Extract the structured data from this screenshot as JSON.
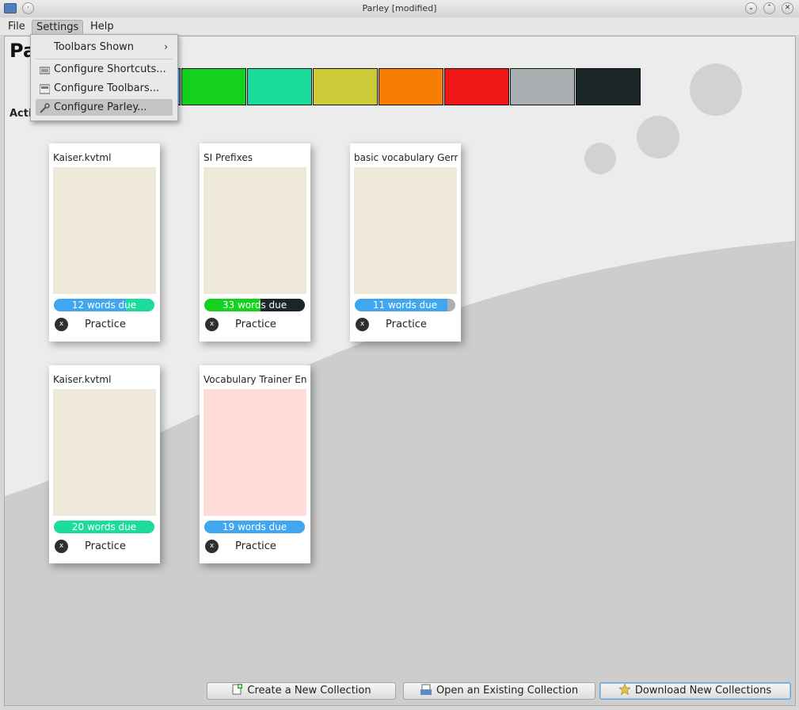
{
  "window": {
    "title": "Parley [modified]"
  },
  "menubar": {
    "file": "File",
    "settings": "Settings",
    "help": "Help"
  },
  "settings_menu": {
    "toolbars_shown": "Toolbars Shown",
    "configure_shortcuts": "Configure Shortcuts...",
    "configure_toolbars": "Configure Toolbars...",
    "configure_parley": "Configure Parley..."
  },
  "page": {
    "title": "Pa",
    "section_label": "Activ"
  },
  "color_strip": [
    "#41a6f0",
    "#14d11e",
    "#1bdc9c",
    "#cccc3a",
    "#f77e03",
    "#ee1616",
    "#aab0b1",
    "#1b2628"
  ],
  "collections": [
    {
      "title": "Kaiser.kvtml",
      "due_label": "12 words due",
      "image_color": "#eee8d8",
      "bar": [
        {
          "color": "#41a6f0",
          "fraction": 0.72
        },
        {
          "color": "#1bdc9c",
          "fraction": 0.28
        }
      ],
      "practice": "Practice"
    },
    {
      "title": "SI Prefixes",
      "due_label": "33 words due",
      "image_color": "#eee8d8",
      "bar": [
        {
          "color": "#14d11e",
          "fraction": 0.56
        },
        {
          "color": "#1b2628",
          "fraction": 0.44
        }
      ],
      "practice": "Practice"
    },
    {
      "title": "basic vocabulary Gern",
      "due_label": "11 words due",
      "image_color": "#eee8d8",
      "bar": [
        {
          "color": "#41a6f0",
          "fraction": 0.92
        },
        {
          "color": "#aab0b1",
          "fraction": 0.08
        }
      ],
      "practice": "Practice"
    },
    {
      "title": "Kaiser.kvtml",
      "due_label": "20 words due",
      "image_color": "#eee8d8",
      "bar": [
        {
          "color": "#1bdc9c",
          "fraction": 1.0
        }
      ],
      "practice": "Practice"
    },
    {
      "title": "Vocabulary Trainer En",
      "due_label": "19 words due",
      "image_color": "#ffdcd7",
      "bar": [
        {
          "color": "#41a6f0",
          "fraction": 1.0
        }
      ],
      "practice": "Practice"
    }
  ],
  "buttons": {
    "create": "Create a New Collection",
    "open": "Open an Existing Collection",
    "download": "Download New Collections"
  },
  "icons": {
    "remove": "x",
    "submenu": "›"
  }
}
